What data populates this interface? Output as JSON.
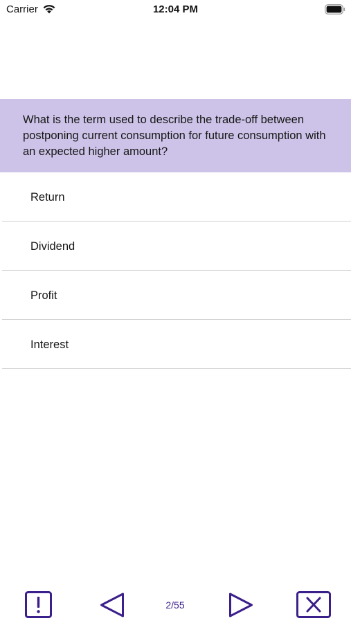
{
  "status_bar": {
    "carrier": "Carrier",
    "time": "12:04 PM",
    "icons": [
      "wifi-icon",
      "battery-icon"
    ]
  },
  "question": {
    "text": "What is the term used to describe the trade-off between postponing current consumption for future consumption with an expected higher amount?"
  },
  "answers": [
    {
      "label": "Return"
    },
    {
      "label": "Dividend"
    },
    {
      "label": "Profit"
    },
    {
      "label": "Interest"
    }
  ],
  "toolbar": {
    "counter": "2/55",
    "icons": [
      "exclamation-icon",
      "triangle-left-icon",
      "triangle-right-icon",
      "close-x-icon"
    ]
  },
  "colors": {
    "accent": "#3b1f8a",
    "banner_bg": "#cdc3e8",
    "divider": "#d2d2d2"
  }
}
